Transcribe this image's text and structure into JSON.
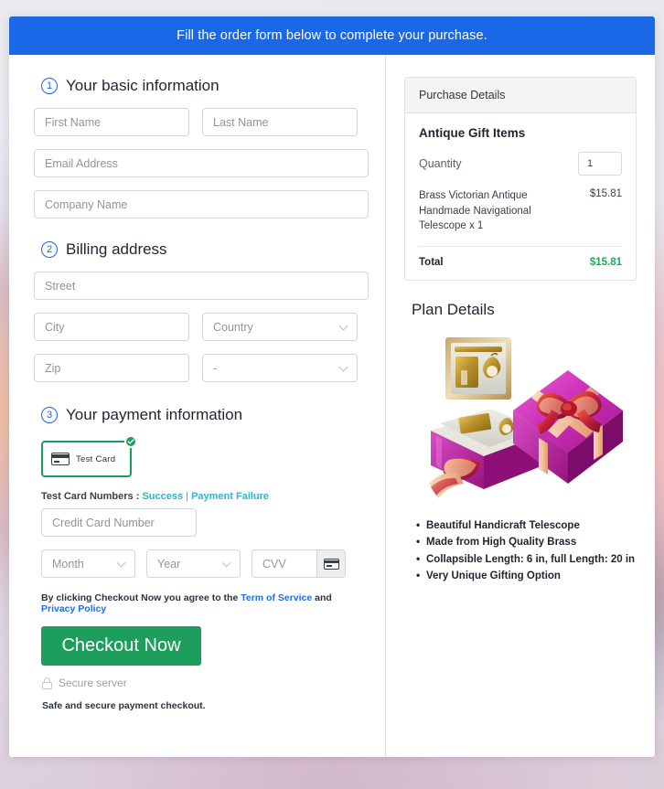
{
  "banner": {
    "text": "Fill the order form below to complete your purchase."
  },
  "sections": {
    "basic": {
      "number": "1",
      "title": "Your basic information",
      "fields": {
        "first_name": "First Name",
        "last_name": "Last Name",
        "email": "Email Address",
        "company": "Company Name"
      }
    },
    "billing": {
      "number": "2",
      "title": "Billing address",
      "fields": {
        "street": "Street",
        "city": "City",
        "country": "Country",
        "zip": "Zip",
        "state": "-"
      }
    },
    "payment": {
      "number": "3",
      "title": "Your payment information",
      "card_option_label": "Test  Card",
      "test_numbers_label": "Test Card Numbers :",
      "link_success": "Success",
      "link_separator": "|",
      "link_failure": "Payment Failure",
      "fields": {
        "credit_card_number": "Credit Card Number",
        "month": "Month",
        "year": "Year",
        "cvv": "CVV"
      }
    }
  },
  "terms": {
    "prefix": "By clicking Checkout Now you agree to the",
    "link_tos": "Term of Service",
    "middle": "and",
    "link_privacy": "Privacy Policy"
  },
  "checkout": {
    "button_label": "Checkout Now",
    "secure_label": "Secure server",
    "safe_note": "Safe and secure payment checkout."
  },
  "purchase": {
    "header": "Purchase Details",
    "product_title": "Antique Gift Items",
    "quantity_label": "Quantity",
    "quantity_value": "1",
    "line_item_name": "Brass Victorian Antique Handmade Navigational Telescope x 1",
    "line_item_price": "$15.81",
    "total_label": "Total",
    "total_value": "$15.81"
  },
  "plan": {
    "title": "Plan Details",
    "features": [
      "Beautiful Handicraft Telescope",
      "Made from High Quality Brass",
      "Collapsible Length: 6 in, full Length: 20 in",
      "Very Unique Gifting Option"
    ]
  },
  "colors": {
    "banner_blue": "#1a67e8",
    "accent_blue": "#1a67e8",
    "green": "#1e9e5c",
    "green_total": "#1cab5a",
    "link_teal": "#2fb4cf",
    "link_blue": "#1f6fe0",
    "gift_pink": "#d43bbd"
  }
}
